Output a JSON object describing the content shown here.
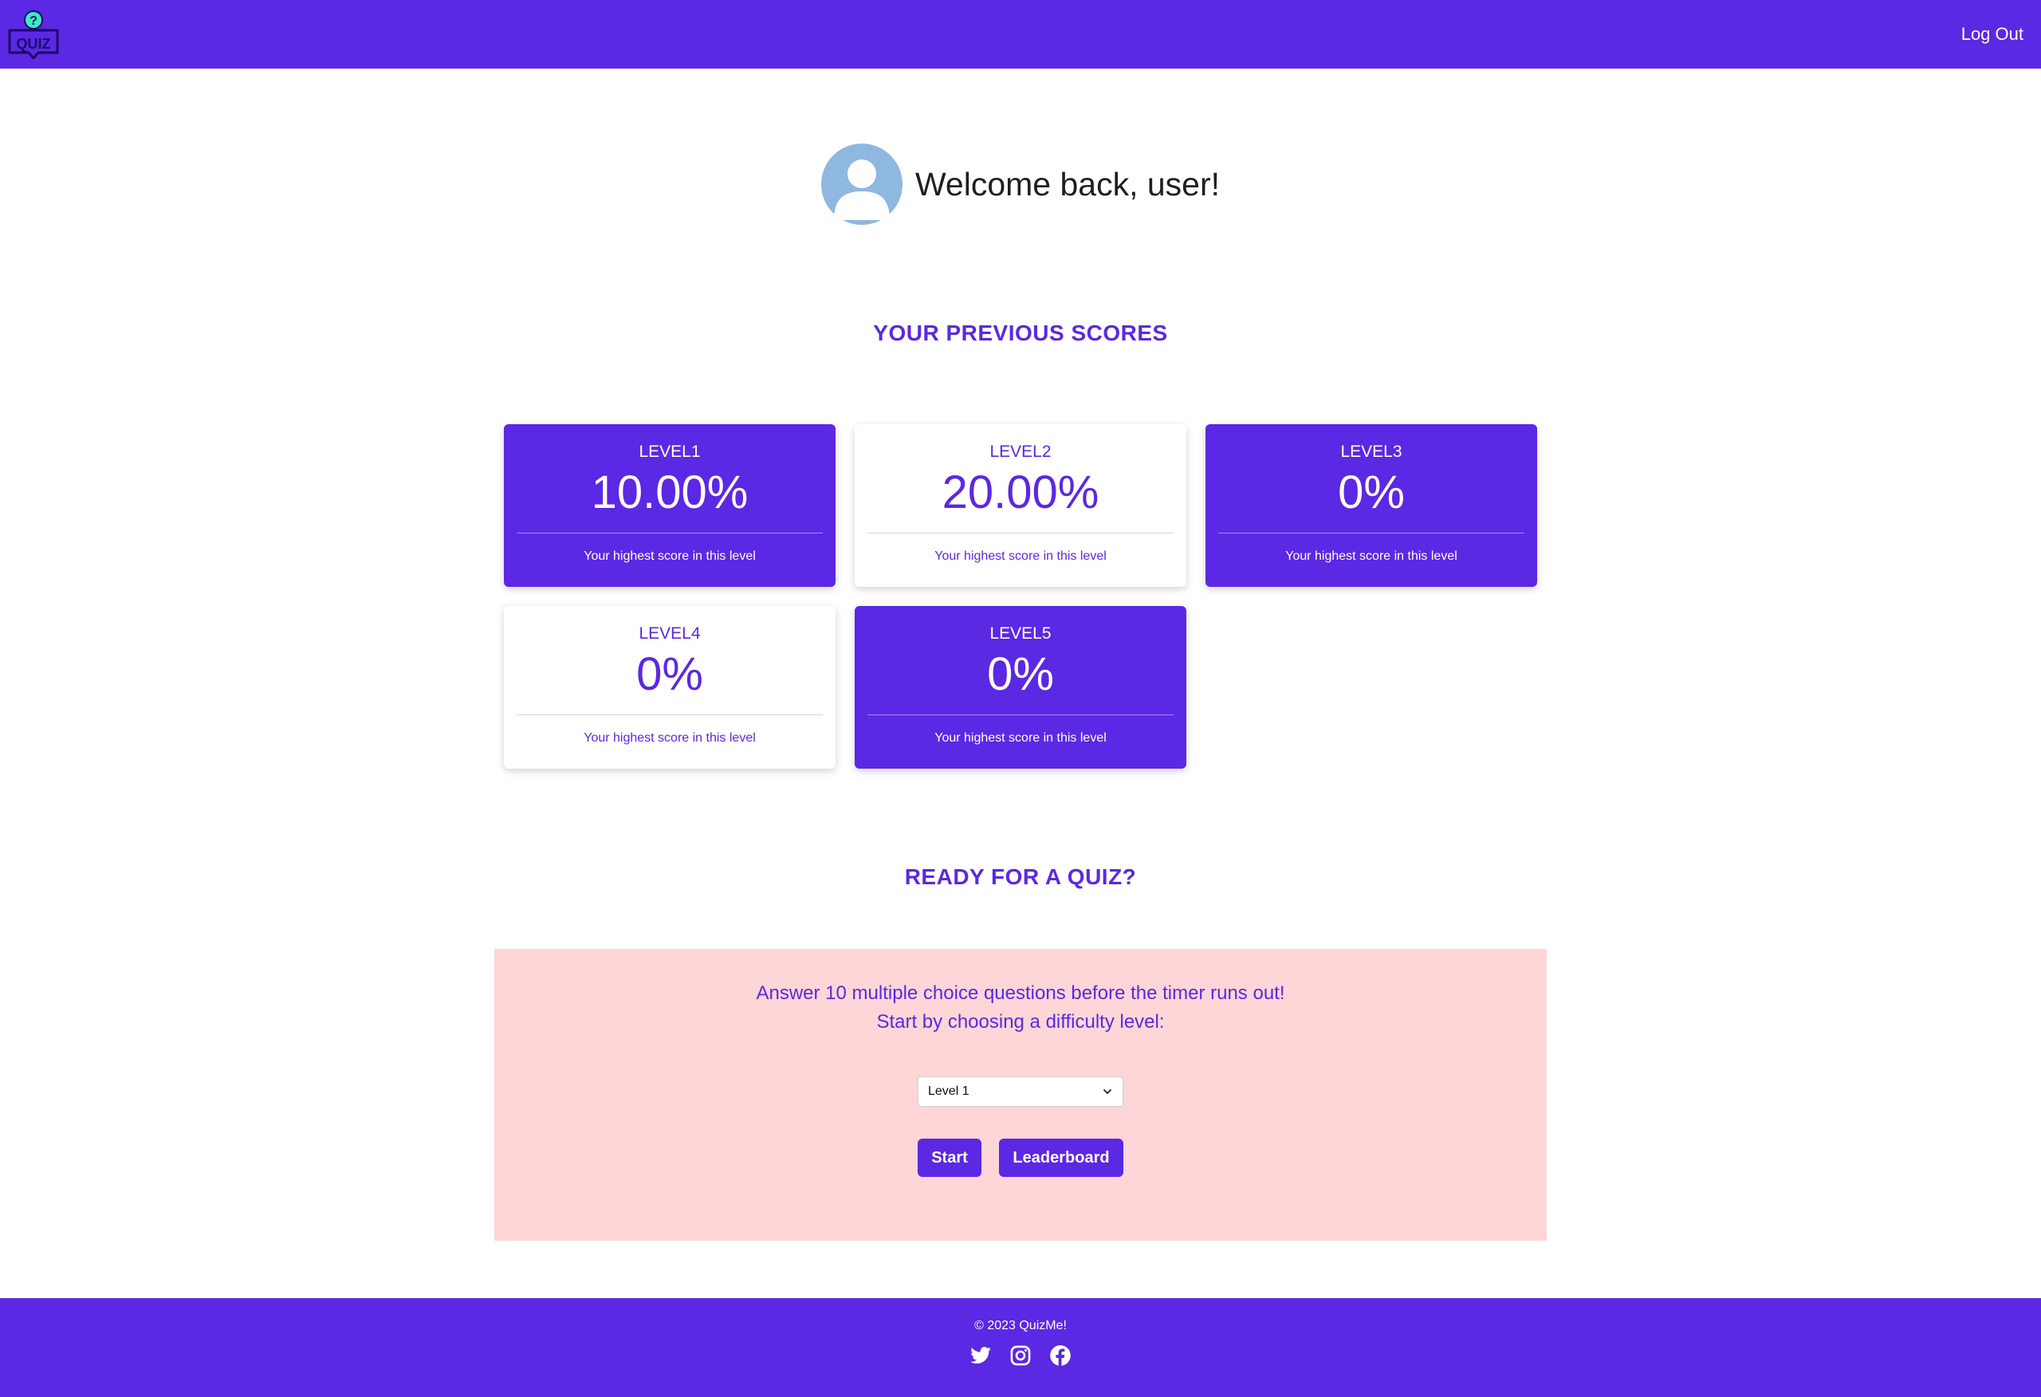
{
  "header": {
    "logo_text": "QUIZ",
    "logout_label": "Log Out"
  },
  "welcome": {
    "text": "Welcome back, user!"
  },
  "scores": {
    "title": "YOUR PREVIOUS SCORES",
    "subtitle": "Your highest score in this level",
    "cards": [
      {
        "level": "LEVEL1",
        "score": "10.00%"
      },
      {
        "level": "LEVEL2",
        "score": "20.00%"
      },
      {
        "level": "LEVEL3",
        "score": "0%"
      },
      {
        "level": "LEVEL4",
        "score": "0%"
      },
      {
        "level": "LEVEL5",
        "score": "0%"
      }
    ]
  },
  "quiz": {
    "title": "READY FOR A QUIZ?",
    "line1": "Answer 10 multiple choice questions before the timer runs out!",
    "line2": "Start by choosing a difficulty level:",
    "select_value": "Level 1",
    "start_label": "Start",
    "leaderboard_label": "Leaderboard"
  },
  "footer": {
    "copyright": "© 2023 QuizMe!"
  },
  "colors": {
    "brand": "#5b28e4",
    "quiz_box_bg": "#ffd6d8",
    "avatar": "#8fb8e0"
  }
}
